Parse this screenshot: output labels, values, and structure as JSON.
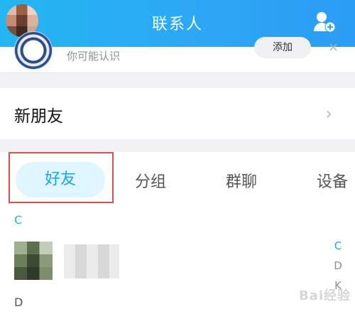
{
  "header": {
    "title": "联系人",
    "add_contact_icon": "add-user-icon",
    "accent_color": "#2aa6f3"
  },
  "recommendation": {
    "subtitle": "你可能认识",
    "button_label": "添加",
    "close_label": "×"
  },
  "new_friends": {
    "label": "新朋友",
    "chevron": "›"
  },
  "tabs": [
    {
      "label": "好友",
      "active": true
    },
    {
      "label": "分组",
      "active": false
    },
    {
      "label": "群聊",
      "active": false
    },
    {
      "label": "设备",
      "active": false
    }
  ],
  "sections": {
    "first_letter": "C",
    "next_letter": "D"
  },
  "index_bar": [
    {
      "letter": "C",
      "active": true
    },
    {
      "letter": "D",
      "active": false
    },
    {
      "letter": "K",
      "active": false
    }
  ],
  "watermark": "Bai经验"
}
